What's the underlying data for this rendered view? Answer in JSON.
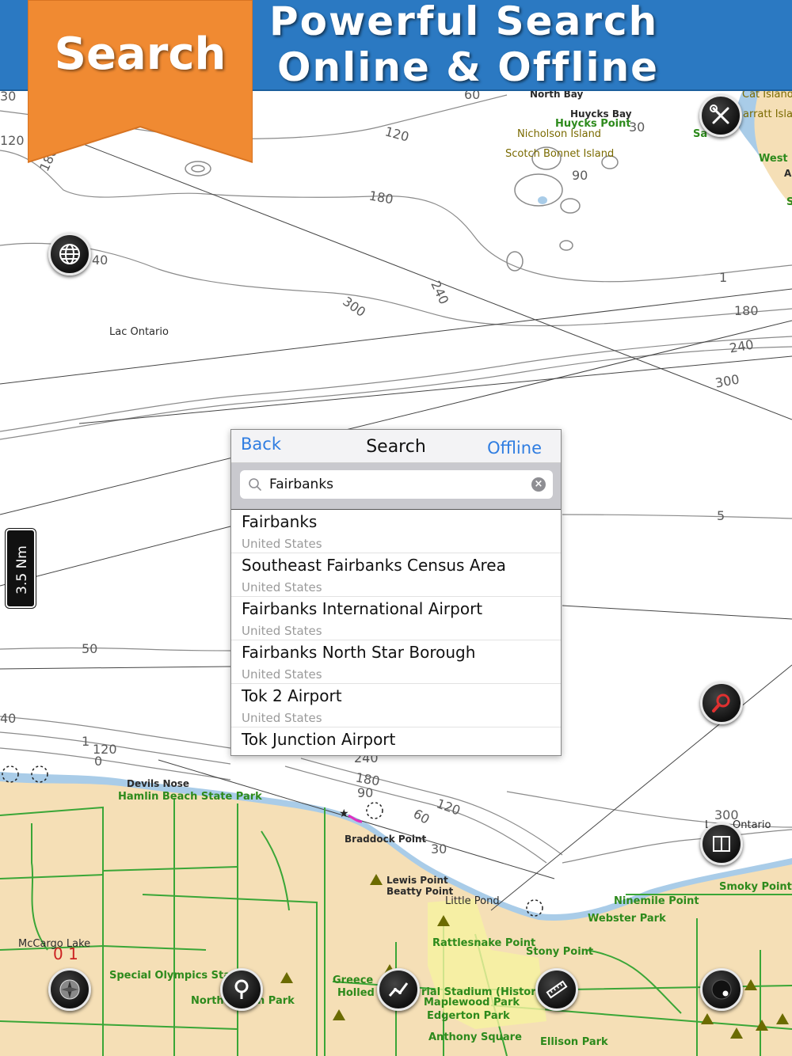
{
  "banner": {
    "ribbon_label": "Search",
    "headline_line1": "Powerful Search",
    "headline_line2": "Online & Offline",
    "colors": {
      "header_blue": "#2b79c2",
      "ribbon_orange": "#f08a32"
    }
  },
  "map": {
    "colors": {
      "land": "#f5dfb6",
      "water": "#ffffff",
      "shallow_water": "#a9cce8",
      "road": "#3aa637",
      "contour": "#8a8a8a"
    },
    "place_labels": [
      "North Bay",
      "Huycks Bay",
      "Huycks Point",
      "Nicholson Island",
      "Scotch Bonnet Island",
      "Cat Island",
      "arratt Islar",
      "Sa",
      "West I",
      "A",
      "S",
      "Lac Ontario",
      "Devils Nose",
      "Hamlin Beach State Park",
      "Braddock Point",
      "Lewis Point",
      "Beatty Point",
      "Little Pond",
      "Ninemile Point",
      "Webster Park",
      "Smoky Point",
      "Rattlesnake Point",
      "Stony Point",
      "McCargo Lake",
      "Special Olympics Sta",
      "North",
      "n Park",
      "Greece",
      "Holled",
      "rial Stadium (Histori",
      "Maplewood Park",
      "Edgerton Park",
      "Anthony Square",
      "Ellison Park",
      "L",
      "Ontario"
    ],
    "depth_labels": [
      "30",
      "60",
      "120",
      "180",
      "30",
      "120",
      "90",
      "180",
      "40",
      "240",
      "300",
      "1",
      "180",
      "240",
      "300",
      "5",
      "50",
      "40",
      "1",
      "120",
      "0",
      "240",
      "180",
      "90",
      "60",
      "120",
      "30",
      "300"
    ],
    "red_label": "0  1"
  },
  "scale": {
    "label": "3.5 Nm"
  },
  "buttons": {
    "tools": "wrench-screwdriver-icon",
    "globe": "globe-icon",
    "search": "search-icon",
    "book": "book-icon",
    "compass": "compass-icon",
    "pin": "location-pin-icon",
    "route": "route-icon",
    "ruler": "ruler-icon",
    "record": "record-icon"
  },
  "search_panel": {
    "back_label": "Back",
    "title": "Search",
    "offline_label": "Offline",
    "query": "Fairbanks",
    "placeholder": "Search",
    "results": [
      {
        "title": "Fairbanks",
        "subtitle": "United States"
      },
      {
        "title": "Southeast Fairbanks Census Area",
        "subtitle": "United States"
      },
      {
        "title": "Fairbanks International Airport",
        "subtitle": "United States"
      },
      {
        "title": "Fairbanks North Star Borough",
        "subtitle": "United States"
      },
      {
        "title": "Tok 2 Airport",
        "subtitle": "United States"
      },
      {
        "title": "Tok Junction Airport",
        "subtitle": ""
      }
    ]
  }
}
